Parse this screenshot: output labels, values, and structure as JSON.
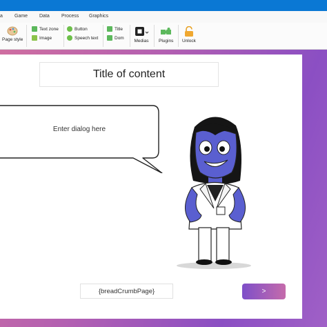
{
  "menu": {
    "items": [
      "a",
      "Game",
      "Data",
      "Process",
      "Graphics"
    ]
  },
  "ribbon": {
    "page_style": "Page style",
    "text_zone": "Text zone",
    "image": "Image",
    "button": "Button",
    "speech_text": "Speech text",
    "title": "Title",
    "dom": "Dom",
    "medias": "Medias",
    "plugins": "Plugins",
    "unlock": "Unlock"
  },
  "content": {
    "title": "Title of content",
    "dialog": "Enter dialog here",
    "breadcrumb": "{breadCrumbPage}",
    "next_label": ">"
  },
  "colors": {
    "accent_blue": "#0a78d4",
    "character_skin": "#5a5fd0",
    "stage_gradient_start": "#cf6ea0",
    "stage_gradient_end": "#8b4fc3"
  }
}
